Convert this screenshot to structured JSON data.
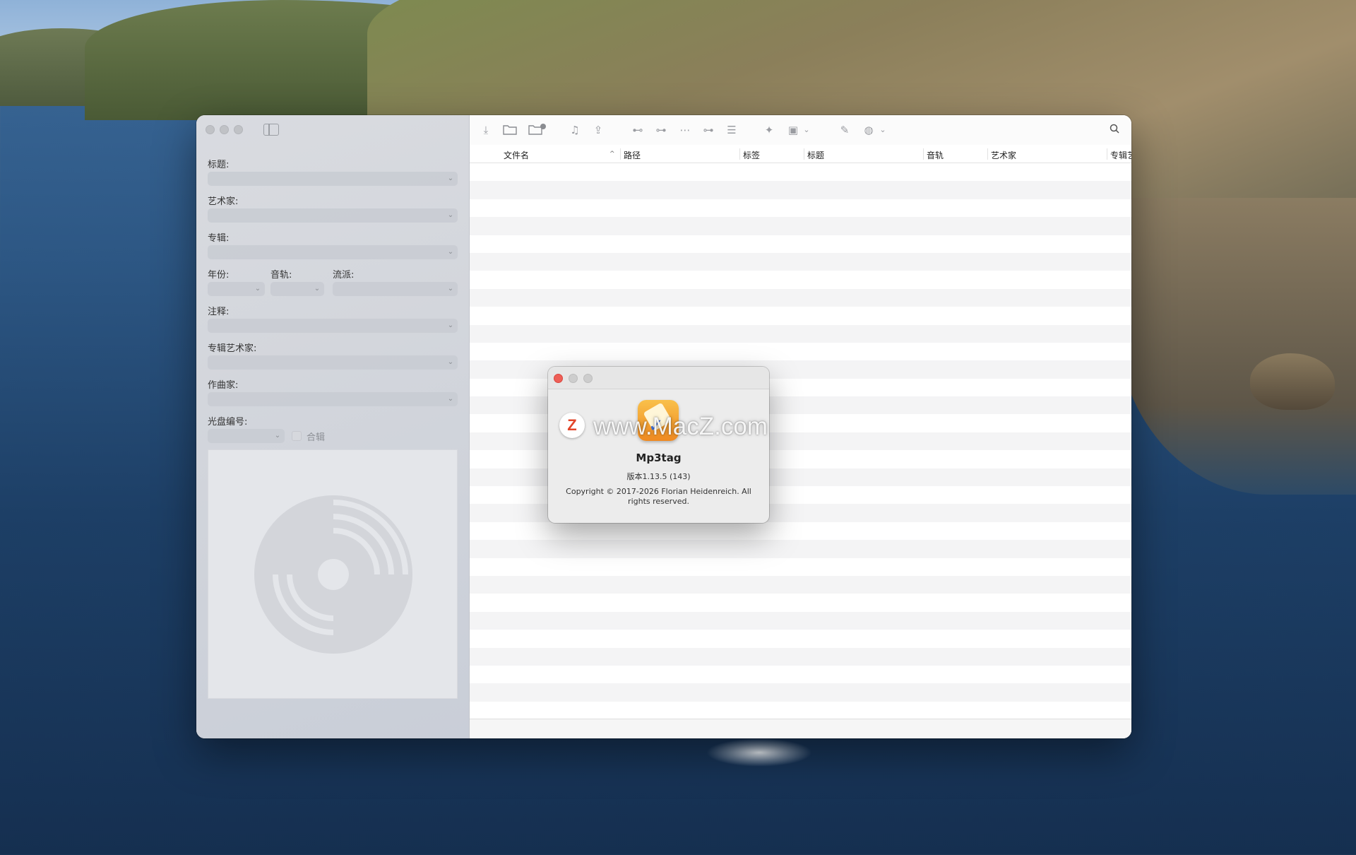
{
  "editor": {
    "labels": {
      "title": "标题:",
      "artist": "艺术家:",
      "album": "专辑:",
      "year": "年份:",
      "track": "音轨:",
      "genre": "流派:",
      "comment": "注释:",
      "album_artist": "专辑艺术家:",
      "composer": "作曲家:",
      "disc_number": "光盘编号:",
      "compilation": "合辑"
    },
    "values": {
      "title": "",
      "artist": "",
      "album": "",
      "year": "",
      "track": "",
      "genre": "",
      "comment": "",
      "album_artist": "",
      "composer": "",
      "disc_number": ""
    }
  },
  "file_list": {
    "columns": [
      "文件名",
      "路径",
      "标签",
      "标题",
      "音轨",
      "艺术家",
      "专辑艺"
    ],
    "sorted_column": "文件名",
    "sort_direction": "ascending"
  },
  "about_dialog": {
    "app_name": "Mp3tag",
    "version": "版本1.13.5 (143)",
    "copyright": "Copyright © 2017-2026 Florian Heidenreich. All rights reserved."
  },
  "watermark": {
    "badge": "Z",
    "text": "www.MacZ.com"
  },
  "colors": {
    "close": "#ee5f57",
    "inactive_light": "#c8c8c8",
    "icon_accent": "#ef8a22"
  }
}
